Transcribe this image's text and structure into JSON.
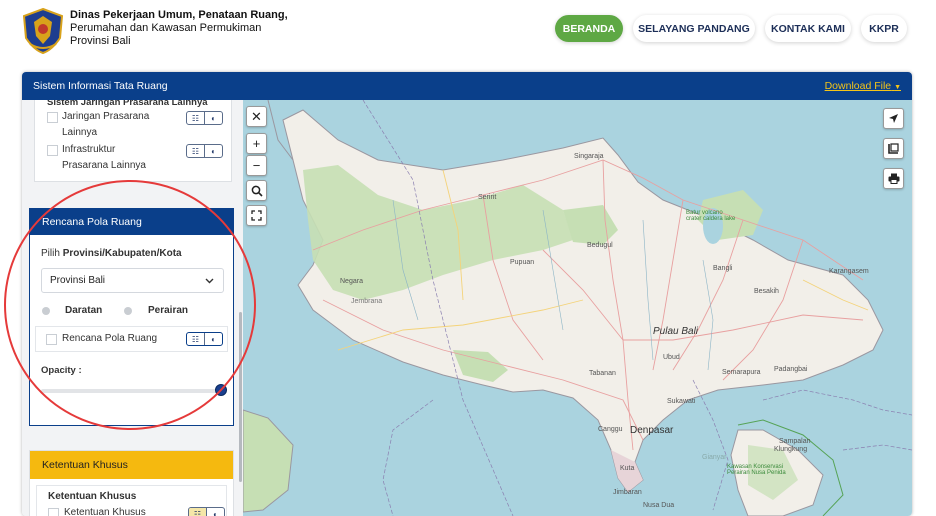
{
  "header": {
    "org_line1": "Dinas Pekerjaan Umum, Penataan Ruang,",
    "org_line2": "Perumahan dan Kawasan Permukiman",
    "org_line3": "Provinsi Bali",
    "nav": [
      "BERANDA",
      "SELAYANG PANDANG",
      "KONTAK KAMI",
      "KKPR"
    ]
  },
  "topbar": {
    "title": "Sistem Informasi Tata Ruang",
    "download": "Download File"
  },
  "sidebar": {
    "section1_title": "Sistem Jaringan Prasarana Lainnya",
    "layers1": [
      "Jaringan Prasarana Lainnya",
      "Infrastruktur Prasarana Lainnya"
    ],
    "pola_header": "Rencana Pola Ruang",
    "pilih_label_prefix": "Pilih ",
    "pilih_label_bold": "Provinsi/Kabupaten/Kota",
    "select_value": "Provinsi Bali",
    "radio_daratan": "Daratan",
    "radio_perairan": "Perairan",
    "layer_pola": "Rencana Pola Ruang",
    "opacity_label": "Opacity :",
    "opacity_value": 1.0,
    "ketentuan_header": "Ketentuan Khusus",
    "ketentuan_title": "Ketentuan Khusus",
    "ketentuan_layer": "Ketentuan Khusus"
  },
  "map": {
    "labels": [
      "Singaraja",
      "Seririt",
      "Pupuan",
      "Negara",
      "Jembrana",
      "Bedugul",
      "Bangli",
      "Karangasem",
      "Besakih",
      "Pulau Bali",
      "Ubud",
      "Semarapura",
      "Padangbai",
      "Tabanan",
      "Sukawati",
      "Canggu",
      "Denpasar",
      "Gianyar",
      "Kuta",
      "Jimbaran",
      "Nusa Dua",
      "Klungkung",
      "Sampalan",
      "Kawasan Konservasi Perairan Nusa Penida",
      "Batur volcano crater caldera lake"
    ],
    "zoom_in": "+",
    "zoom_out": "−"
  },
  "colors": {
    "brand_blue": "#0a3f8a",
    "nav_green": "#5ea844",
    "download_yellow": "#f5c518",
    "ketentuan_yellow": "#f5b90f",
    "annotation_red": "#e53a3a"
  }
}
